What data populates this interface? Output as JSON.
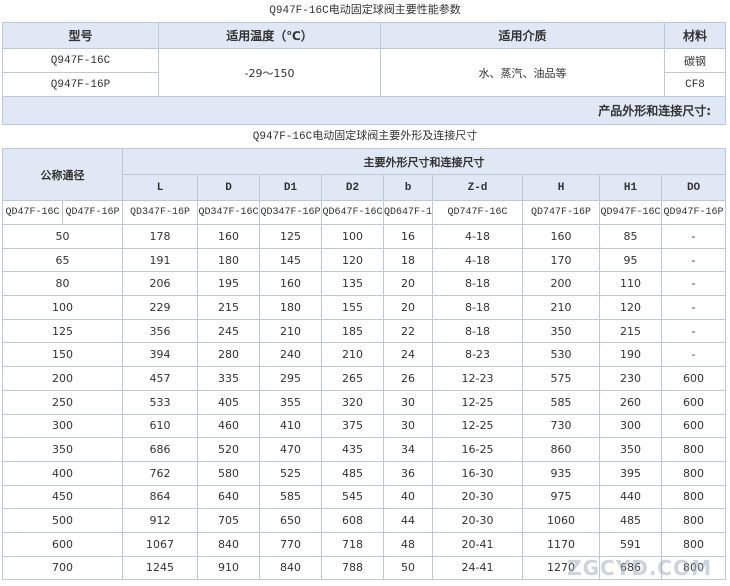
{
  "title1": "Q947F-16C电动固定球阀主要性能参数",
  "perf": {
    "headers": [
      "型号",
      "适用温度（℃）",
      "适用介质",
      "材料"
    ],
    "models": [
      "Q947F-16C",
      "Q947F-16P"
    ],
    "temperature": "-29～150",
    "medium": "水、蒸汽、油品等",
    "materials": [
      "碳钢",
      "CF8"
    ],
    "footer": "产品外形和连接尺寸:"
  },
  "title2": "Q947F-16C电动固定球阀主要外形及连接尺寸",
  "dims": {
    "nominal_label": "公称通径",
    "group_label": "主要外形尺寸和连接尺寸",
    "columns": [
      "L",
      "D",
      "D1",
      "D2",
      "b",
      "Z-d",
      "H",
      "H1",
      "DO"
    ],
    "model_row": [
      "QD47F-16C",
      "QD47F-16P",
      "QD347F-16P",
      "QD347F-16C",
      "QD347F-16P",
      "QD647F-16C",
      "QD647F-16P",
      "QD747F-16C",
      "QD747F-16P",
      "QD947F-16C",
      "QD947F-16P"
    ],
    "rows": [
      [
        "50",
        "178",
        "160",
        "125",
        "100",
        "16",
        "4-18",
        "160",
        "85",
        "-"
      ],
      [
        "65",
        "191",
        "180",
        "145",
        "120",
        "18",
        "4-18",
        "170",
        "95",
        "-"
      ],
      [
        "80",
        "206",
        "195",
        "160",
        "135",
        "20",
        "8-18",
        "200",
        "110",
        "-"
      ],
      [
        "100",
        "229",
        "215",
        "180",
        "155",
        "20",
        "8-18",
        "210",
        "120",
        "-"
      ],
      [
        "125",
        "356",
        "245",
        "210",
        "185",
        "22",
        "8-18",
        "350",
        "215",
        "-"
      ],
      [
        "150",
        "394",
        "280",
        "240",
        "210",
        "24",
        "8-23",
        "530",
        "190",
        "-"
      ],
      [
        "200",
        "457",
        "335",
        "295",
        "265",
        "26",
        "12-23",
        "575",
        "230",
        "600"
      ],
      [
        "250",
        "533",
        "405",
        "355",
        "320",
        "30",
        "12-25",
        "585",
        "260",
        "600"
      ],
      [
        "300",
        "610",
        "460",
        "410",
        "375",
        "30",
        "12-25",
        "730",
        "300",
        "600"
      ],
      [
        "350",
        "686",
        "520",
        "470",
        "435",
        "34",
        "16-25",
        "860",
        "350",
        "800"
      ],
      [
        "400",
        "762",
        "580",
        "525",
        "485",
        "36",
        "16-30",
        "935",
        "395",
        "800"
      ],
      [
        "450",
        "864",
        "640",
        "585",
        "545",
        "40",
        "20-30",
        "975",
        "440",
        "800"
      ],
      [
        "500",
        "912",
        "705",
        "650",
        "608",
        "44",
        "20-30",
        "1060",
        "485",
        "800"
      ],
      [
        "600",
        "1067",
        "840",
        "770",
        "718",
        "48",
        "20-41",
        "1170",
        "591",
        "800"
      ],
      [
        "700",
        "1245",
        "910",
        "840",
        "788",
        "50",
        "24-41",
        "1270",
        "686",
        "800"
      ]
    ]
  },
  "watermark": "ZGCYD.COM"
}
